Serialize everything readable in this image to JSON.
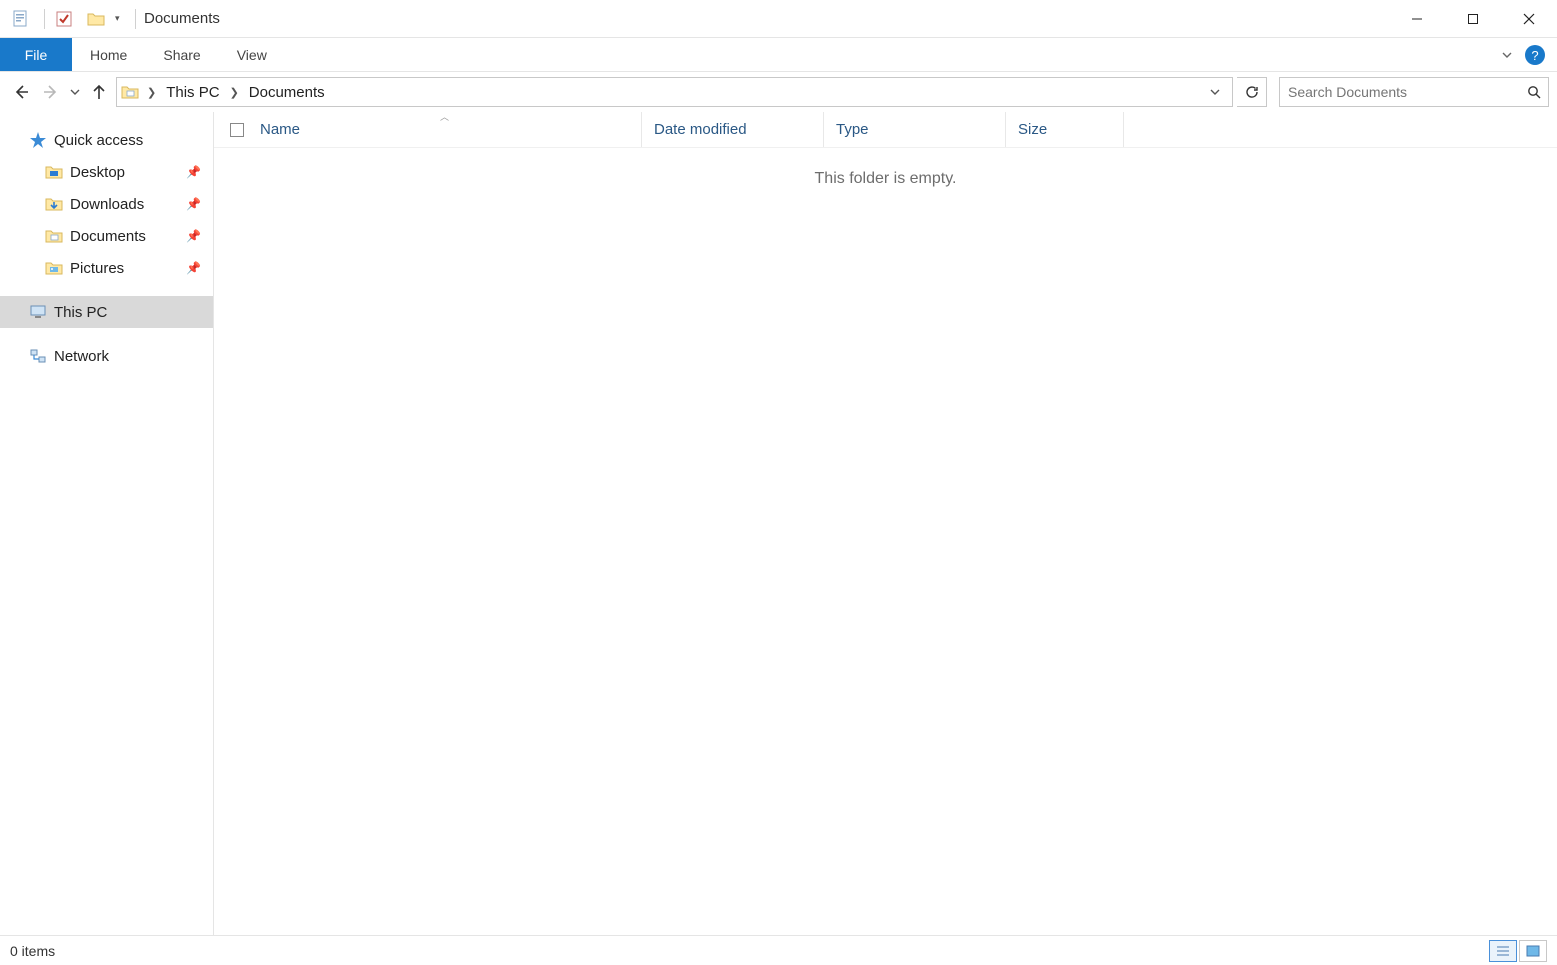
{
  "titlebar": {
    "title": "Documents"
  },
  "ribbon": {
    "file": "File",
    "tabs": [
      "Home",
      "Share",
      "View"
    ],
    "help": "?"
  },
  "nav": {
    "breadcrumb": [
      "This PC",
      "Documents"
    ],
    "search_placeholder": "Search Documents"
  },
  "sidebar": {
    "quick_access": "Quick access",
    "items": [
      {
        "label": "Desktop"
      },
      {
        "label": "Downloads"
      },
      {
        "label": "Documents"
      },
      {
        "label": "Pictures"
      }
    ],
    "this_pc": "This PC",
    "network": "Network"
  },
  "columns": {
    "name": "Name",
    "date": "Date modified",
    "type": "Type",
    "size": "Size"
  },
  "main": {
    "empty_msg": "This folder is empty."
  },
  "statusbar": {
    "count": "0 items"
  }
}
